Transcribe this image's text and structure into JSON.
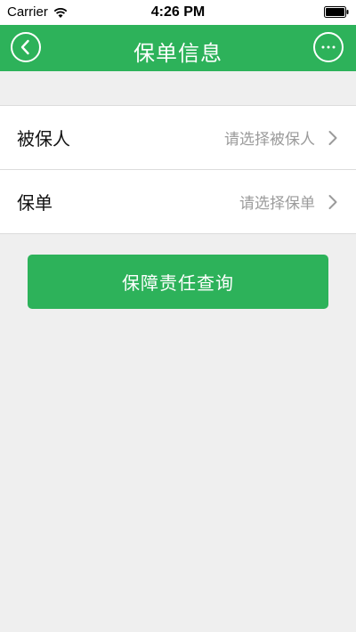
{
  "status_bar": {
    "carrier": "Carrier",
    "time": "4:26 PM"
  },
  "nav": {
    "title": "保单信息",
    "back_icon": "chevron-left-icon",
    "more_icon": "ellipsis-icon",
    "color": "#2db25a"
  },
  "form": {
    "rows": [
      {
        "label": "被保人",
        "placeholder": "请选择被保人"
      },
      {
        "label": "保单",
        "placeholder": "请选择保单"
      }
    ]
  },
  "actions": {
    "query_label": "保障责任查询",
    "button_color": "#2db25a"
  }
}
